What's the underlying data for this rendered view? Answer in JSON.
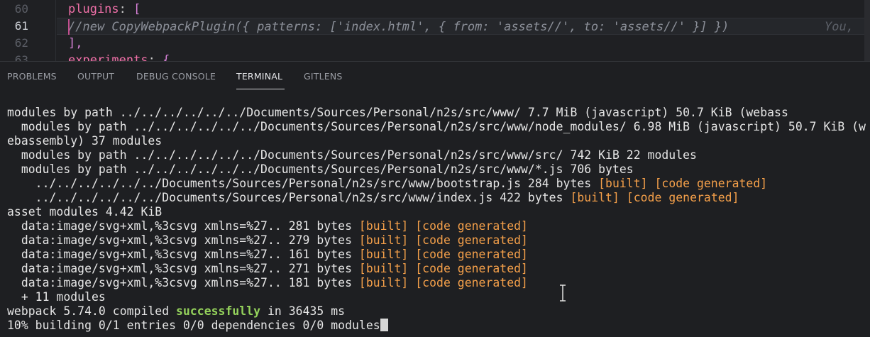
{
  "editor": {
    "lines": [
      {
        "number": "60",
        "key": "plugins",
        "rest": ": ",
        "bracket": "["
      },
      {
        "number": "61",
        "comment": "//new CopyWebpackPlugin({ patterns: ['index.html', { from: 'assets//', to: 'assets//' }] })",
        "blame": "You,"
      },
      {
        "number": "62",
        "text": "],"
      },
      {
        "number": "63",
        "key": "experiments",
        "rest": ": ",
        "bracket": "{"
      }
    ]
  },
  "panel": {
    "tabs": [
      {
        "label": "PROBLEMS"
      },
      {
        "label": "OUTPUT"
      },
      {
        "label": "DEBUG CONSOLE"
      },
      {
        "label": "TERMINAL",
        "active": true
      },
      {
        "label": "GITLENS"
      }
    ]
  },
  "terminal": {
    "l1": "modules by path ../../../../../../Documents/Sources/Personal/n2s/src/www/ 7.7 MiB (javascript) 50.7 KiB (webass",
    "l2": "  modules by path ../../../../../../Documents/Sources/Personal/n2s/src/www/node_modules/ 6.98 MiB (javascript) 50.7 KiB (w",
    "l3": "ebassembly) 37 modules",
    "l4": "  modules by path ../../../../../../Documents/Sources/Personal/n2s/src/www/src/ 742 KiB 22 modules",
    "l5": "  modules by path ../../../../../../Documents/Sources/Personal/n2s/src/www/*.js 706 bytes",
    "l6_text": "    ../../../../../../Documents/Sources/Personal/n2s/src/www/bootstrap.js 284 bytes ",
    "l7_text": "    ../../../../../../Documents/Sources/Personal/n2s/src/www/index.js 422 bytes ",
    "l8": "asset modules 4.42 KiB",
    "data_rows": [
      {
        "text": "  data:image/svg+xml,%3csvg xmlns=%27.. 281 bytes "
      },
      {
        "text": "  data:image/svg+xml,%3csvg xmlns=%27.. 279 bytes "
      },
      {
        "text": "  data:image/svg+xml,%3csvg xmlns=%27.. 161 bytes "
      },
      {
        "text": "  data:image/svg+xml,%3csvg xmlns=%27.. 271 bytes "
      },
      {
        "text": "  data:image/svg+xml,%3csvg xmlns=%27.. 181 bytes "
      }
    ],
    "built_tag": "[built]",
    "code_tag": "[code generated]",
    "more_modules": "  + 11 modules",
    "compiled_prefix": "webpack 5.74.0 compiled ",
    "compiled_status": "successfully",
    "compiled_suffix": " in 36435 ms",
    "progress": "10% building 0/1 entries 0/0 dependencies 0/0 modules"
  },
  "colors": {
    "orange": "#f5a04a",
    "green": "#95d35c",
    "accent_pink": "#f070a8"
  }
}
